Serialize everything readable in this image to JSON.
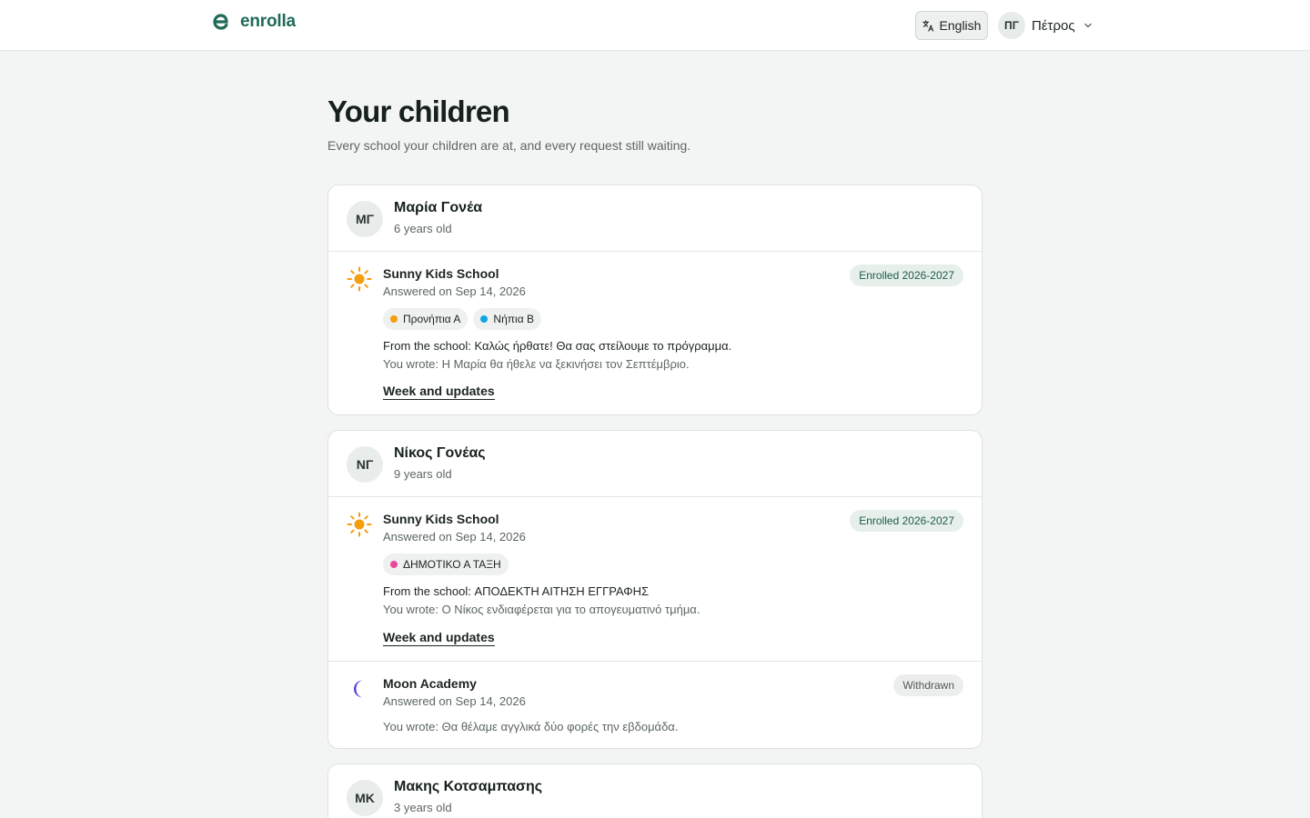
{
  "brand": {
    "name": "enrolla"
  },
  "header": {
    "language_label": "English",
    "user_initials": "ΠΓ",
    "user_name": "Πέτρος"
  },
  "page": {
    "title": "Your children",
    "subtitle": "Every school your children are at, and every request still waiting."
  },
  "children": [
    {
      "initials": "ΜΓ",
      "name": "Μαρία Γονέα",
      "age": "6 years old",
      "enrollments": [
        {
          "school": "Sunny Kids School",
          "icon": "sun-icon",
          "answered": "Answered on Sep 14, 2026",
          "status": "Enrolled 2026-2027",
          "classes": [
            {
              "label": "Προνήπια Α",
              "color": "#f59e0b"
            },
            {
              "label": "Νήπια Β",
              "color": "#0ea5e9"
            }
          ],
          "from_label": "From the school:",
          "from_text": "Καλώς ήρθατε! Θα σας στείλουμε το πρόγραμμα.",
          "wrote_label": "You wrote:",
          "wrote_text": "Η Μαρία θα ήθελε να ξεκινήσει τον Σεπτέμβριο.",
          "link": "Week and updates"
        }
      ]
    },
    {
      "initials": "ΝΓ",
      "name": "Νίκος Γονέας",
      "age": "9 years old",
      "enrollments": [
        {
          "school": "Sunny Kids School",
          "icon": "sun-icon",
          "answered": "Answered on Sep 14, 2026",
          "status": "Enrolled 2026-2027",
          "classes": [
            {
              "label": "ΔΗΜΟΤΙΚΟ Α ΤΑΞΗ",
              "color": "#ec4899"
            }
          ],
          "from_label": "From the school:",
          "from_text": "ΑΠΟΔΕΚΤΗ ΑΙΤΗΣΗ ΕΓΓΡΑΦΗΣ",
          "wrote_label": "You wrote:",
          "wrote_text": "Ο Νίκος ενδιαφέρεται για το απογευματινό τμήμα.",
          "link": "Week and updates"
        },
        {
          "school": "Moon Academy",
          "icon": "moon-icon",
          "answered": "Answered on Sep 14, 2026",
          "status": "Withdrawn",
          "wrote_label": "You wrote:",
          "wrote_text": "Θα θέλαμε αγγλικά δύο φορές την εβδομάδα."
        }
      ]
    },
    {
      "initials": "ΜΚ",
      "name": "Μακης Κοτσαμπασης",
      "age": "3 years old",
      "enrollments": []
    }
  ],
  "colors": {
    "brand": "#1f6b57",
    "sun": "#f59e0b",
    "moon": "#5b3fd6",
    "enrolled_bg": "#e6efea",
    "enrolled_text": "#1e5c4c",
    "withdrawn_bg": "#eceeed"
  }
}
